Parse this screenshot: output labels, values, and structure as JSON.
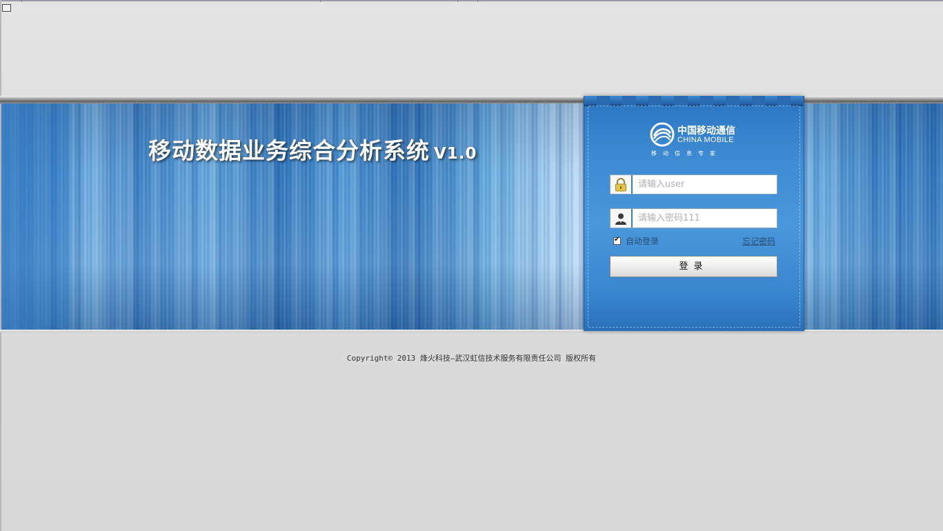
{
  "window": {
    "title": "移动数据业务综合分析系统",
    "version": "V1.0"
  },
  "brand": {
    "logo_cn": "中国移动通信",
    "logo_en": "CHINA MOBILE",
    "logo_sub": "移动信息专家"
  },
  "login": {
    "username_placeholder": "请输入user",
    "password_placeholder": "请输入密码111",
    "remember_label": "自动登录",
    "remember_checked": true,
    "forgot_label": "忘记密码",
    "submit_label": "登录"
  },
  "footer": {
    "copyright": "Copyright© 2013  烽火科技—武汉虹信技术服务有限责任公司 版权所有"
  },
  "colors": {
    "accent_blue": "#3d8ad3",
    "panel_dark": "#2a6ab0",
    "background_gray": "#dcdcdc"
  },
  "icons": {
    "username": "lock-icon",
    "password": "user-silhouette-icon",
    "window_corner": "window-restore-icon"
  }
}
